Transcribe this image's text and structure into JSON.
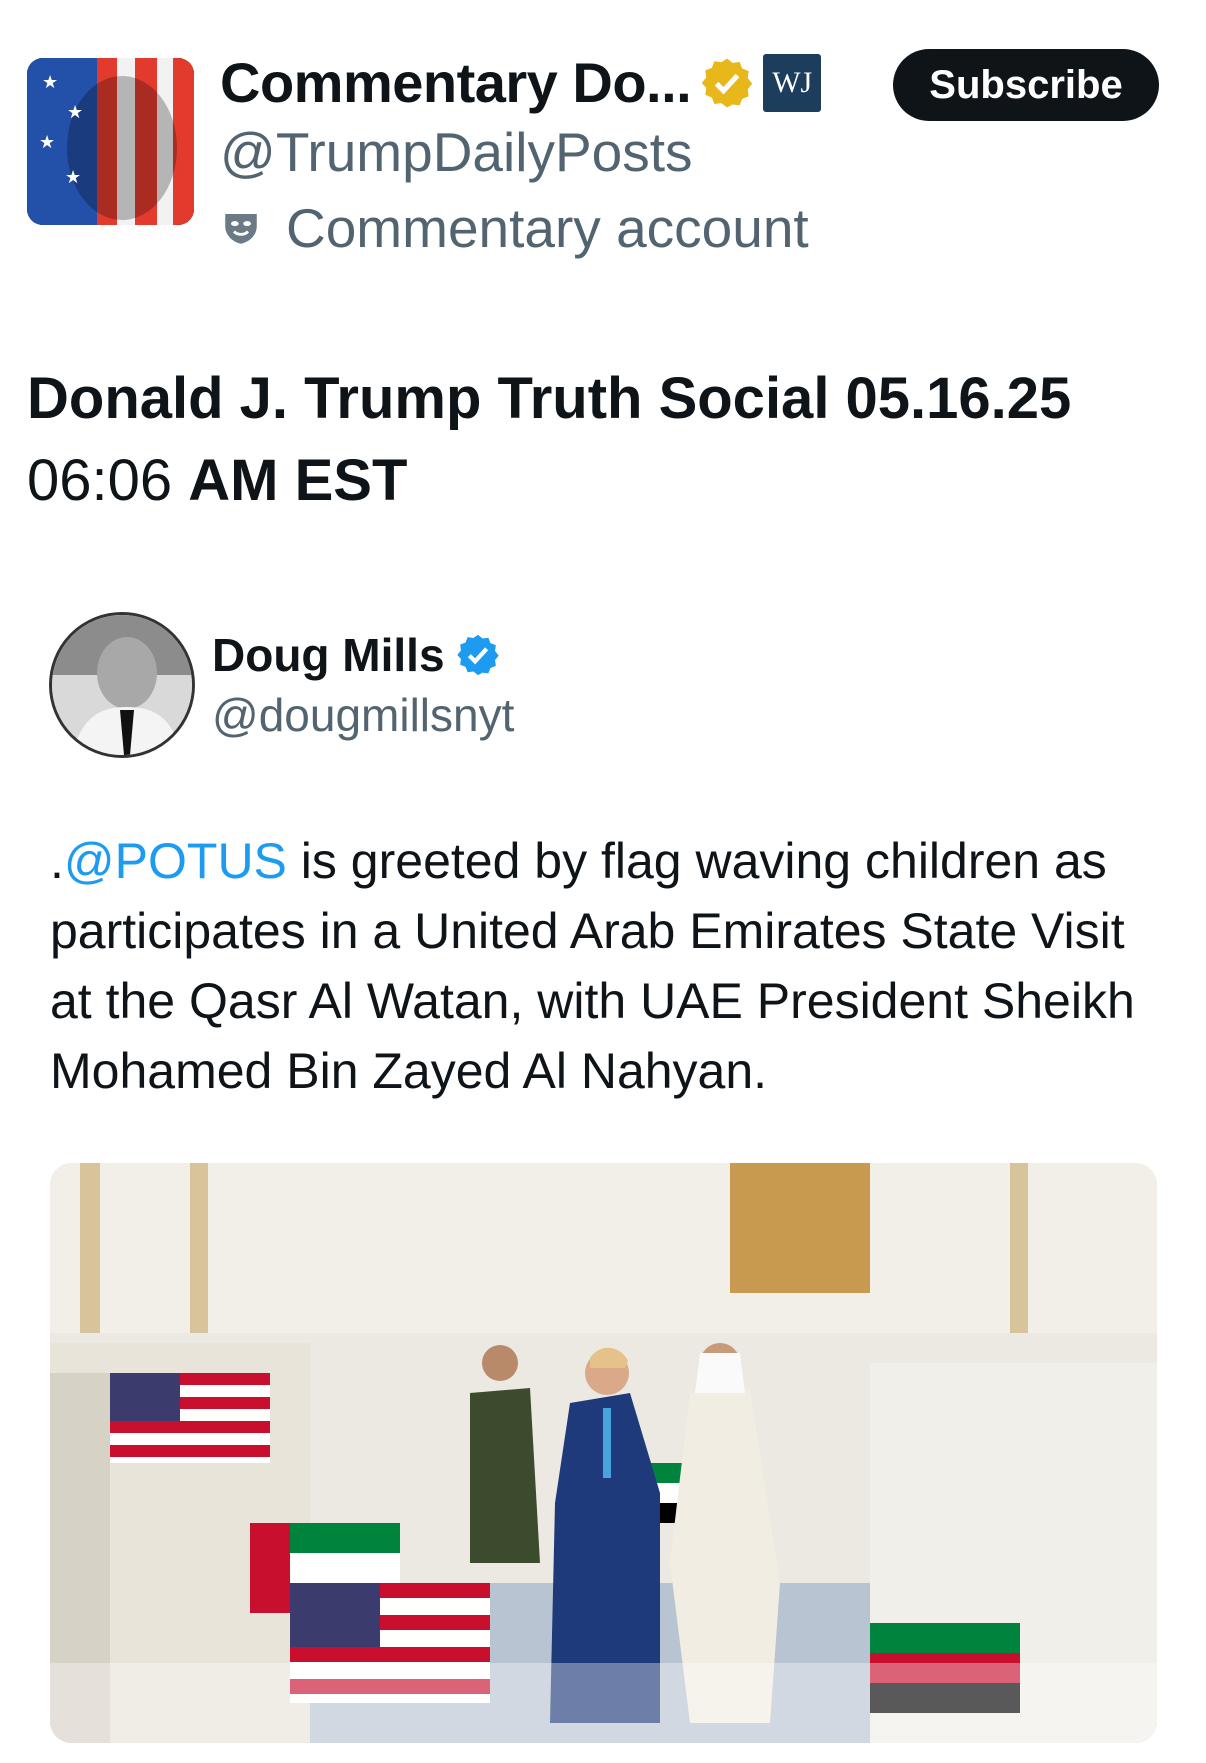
{
  "header": {
    "display_name": "Commentary Do...",
    "badge_text": "WJ",
    "handle": "@TrumpDailyPosts",
    "account_type": "Commentary account",
    "subscribe_label": "Subscribe"
  },
  "post": {
    "title_bold": "Donald J. Trump Truth Social 05.16.25",
    "time": "06:06",
    "time_suffix": "AM EST"
  },
  "quoted": {
    "name": "Doug Mills",
    "handle": "@dougmillsnyt",
    "text_prefix": ".",
    "mention": "@POTUS",
    "text_body": " is greeted by flag waving children as participates in a United Arab Emirates State Visit at the Qasr Al Watan, with UAE President Sheikh Mohamed Bin Zayed Al Nahyan."
  },
  "colors": {
    "accent_blue": "#1d9bf0",
    "verified_gold": "#e8b71a",
    "muted_text": "#536471",
    "button_bg": "#0f1419"
  },
  "icons": [
    "gold-verified-icon",
    "wj-badge-icon",
    "commentary-mask-icon",
    "blue-verified-icon"
  ]
}
